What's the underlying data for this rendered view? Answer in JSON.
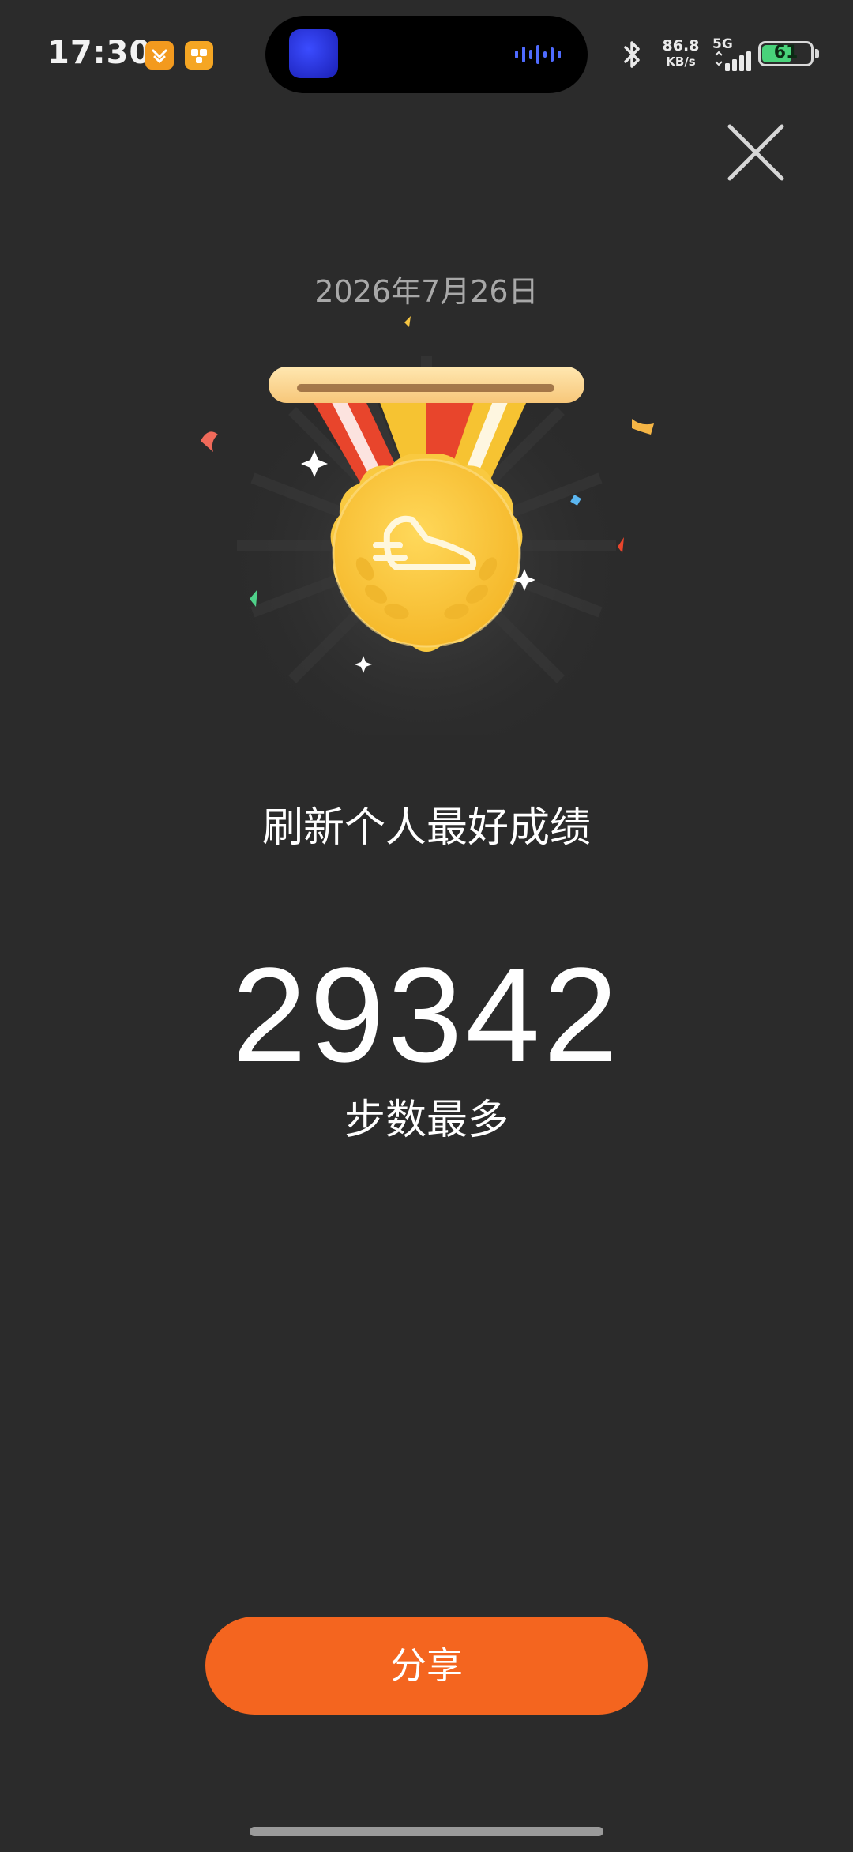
{
  "status_bar": {
    "time": "17:30",
    "net_speed_value": "86.8",
    "net_speed_unit": "KB/s",
    "signal_label": "5G",
    "battery_level": "61",
    "battery_fraction": 0.61,
    "icons": [
      "app-notification-icon",
      "app-notification-icon",
      "media-avatar-icon",
      "audio-wave-icon",
      "bluetooth-icon",
      "signal-icon",
      "battery-icon"
    ]
  },
  "achievement": {
    "date": "2026年7月26日",
    "headline": "刷新个人最好成绩",
    "value": "29342",
    "label": "步数最多",
    "medal_icon": "running-shoe-medal-icon"
  },
  "actions": {
    "share_label": "分享",
    "close_icon": "close-icon"
  },
  "colors": {
    "background": "#2b2b2b",
    "accent": "#f4651f",
    "medal_gold": "#f9c940",
    "ribbon_red": "#e8452c",
    "ribbon_yellow": "#f6c332"
  }
}
